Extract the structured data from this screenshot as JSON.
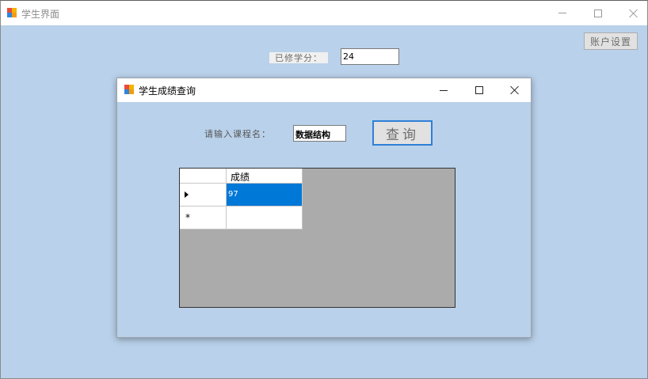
{
  "outer_window": {
    "title": "学生界面",
    "account_button": "账户设置",
    "credits_label": "已修学分：",
    "credits_value": "24"
  },
  "dialog": {
    "title": "学生成绩查询",
    "course_label": "请输入课程名：",
    "course_value": "数据结构",
    "query_button": "查询",
    "grid": {
      "columns": [
        "成绩"
      ],
      "rows": [
        {
          "score": "97",
          "selected": true
        },
        {
          "score": "",
          "new_row": true
        }
      ]
    }
  },
  "colors": {
    "background": "#b9d1ea",
    "selection": "#0078d7",
    "grid_background": "#ababab",
    "button_focus_border": "#2f7fd6"
  },
  "icons": [
    "app-icon",
    "minimize-icon",
    "maximize-icon",
    "close-icon",
    "current-row-arrow-icon",
    "new-row-asterisk-icon"
  ]
}
